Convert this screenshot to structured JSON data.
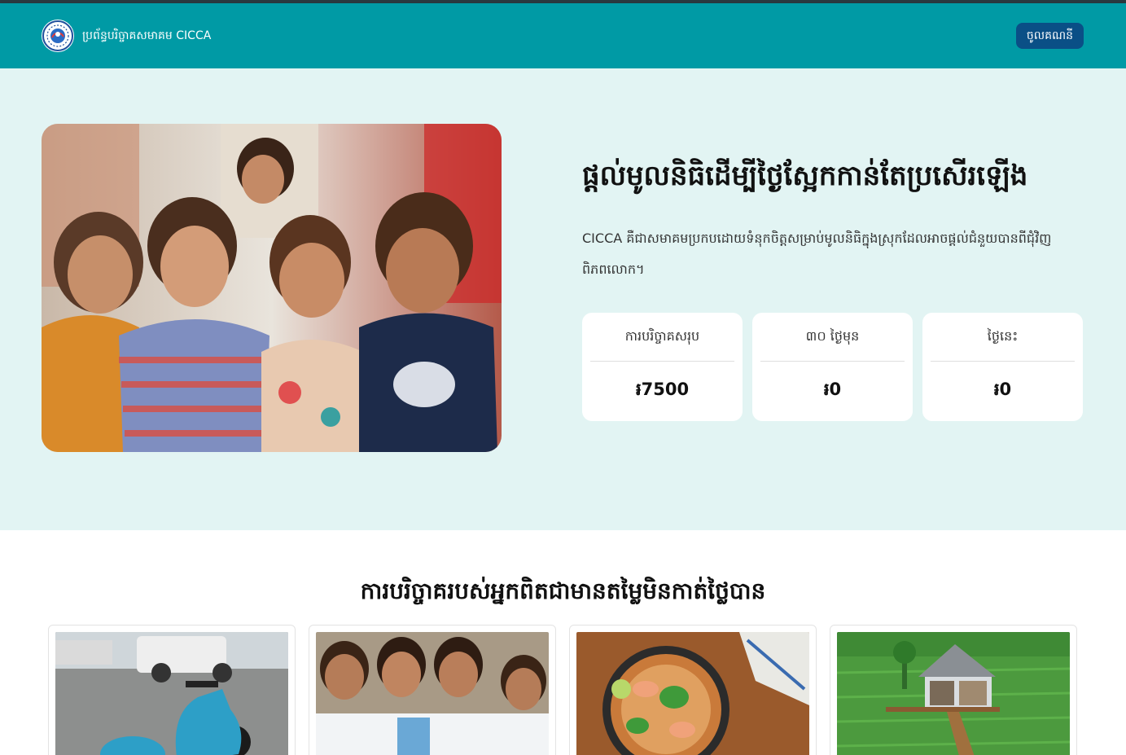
{
  "nav": {
    "brand": "ប្រព័ន្ធបរិច្ចាគសមាគម CICCA",
    "login": "ចូលគណនី"
  },
  "hero": {
    "title": "ផ្តល់មូលនិធិដើម្បីថ្ងៃស្អែកកាន់តែប្រសើរឡើង",
    "description": "CICCA គឺជាសមាគមប្រកបដោយទំនុកចិត្តសម្រាប់មូលនិធិក្នុងស្រុកដែលអាចផ្តល់ជំនួយបានពីជុំវិញពិភពលោក។"
  },
  "stats": [
    {
      "label": "ការបរិច្ចាគសរុប",
      "value": "៛7500"
    },
    {
      "label": "៣០ ថ្ងៃមុន",
      "value": "៛0"
    },
    {
      "label": "ថ្ងៃនេះ",
      "value": "៛0"
    }
  ],
  "section": {
    "title": "ការបរិច្ចាគរបស់អ្នកពិតជាមានតម្លៃមិនកាត់ថ្លៃបាន"
  },
  "colors": {
    "navbar": "#009aa5",
    "button": "#0a4f86",
    "hero_bg": "#e2f4f3"
  }
}
